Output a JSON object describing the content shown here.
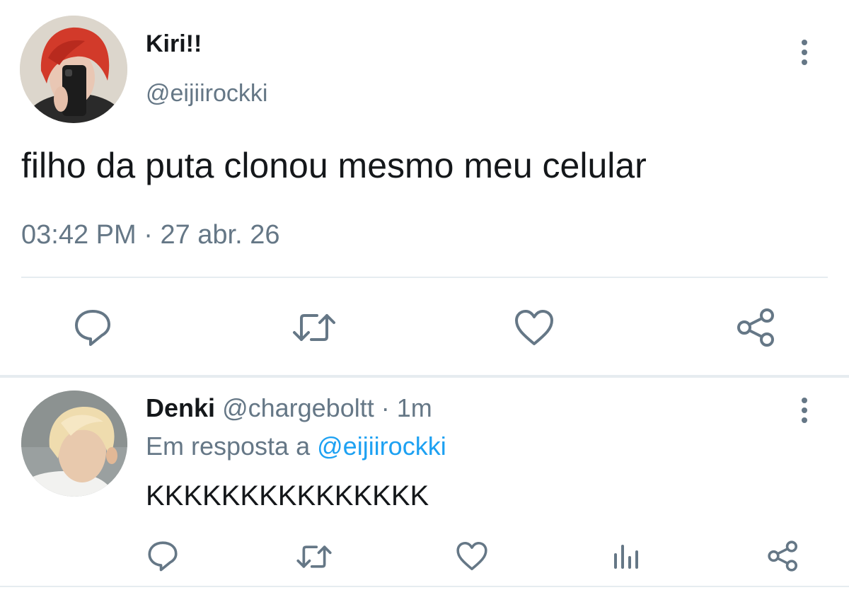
{
  "main_tweet": {
    "display_name": "Kiri!!",
    "handle": "@eijiirockki",
    "text": "filho da puta clonou mesmo meu celular",
    "time": "03:42 PM",
    "separator": "·",
    "date": "27 abr. 26",
    "avatar_icon": "avatar-red-hair-photo",
    "more_icon": "more-vertical-icon",
    "actions": [
      "reply-icon",
      "retweet-icon",
      "like-icon",
      "share-icon"
    ]
  },
  "reply": {
    "display_name": "Denki",
    "handle": "@chargeboltt",
    "separator": "·",
    "age": "1m",
    "in_reply_prefix": "Em resposta a",
    "in_reply_handle": "@eijiirockki",
    "text": "KKKKKKKKKKKKKKK",
    "avatar_icon": "avatar-blonde-hair-photo",
    "more_icon": "more-vertical-icon",
    "actions": [
      "reply-icon",
      "retweet-icon",
      "like-icon",
      "analytics-icon",
      "share-icon"
    ]
  },
  "colors": {
    "text": "#14171a",
    "muted": "#657786",
    "link": "#1da1f2",
    "divider": "#e6ecf0"
  }
}
